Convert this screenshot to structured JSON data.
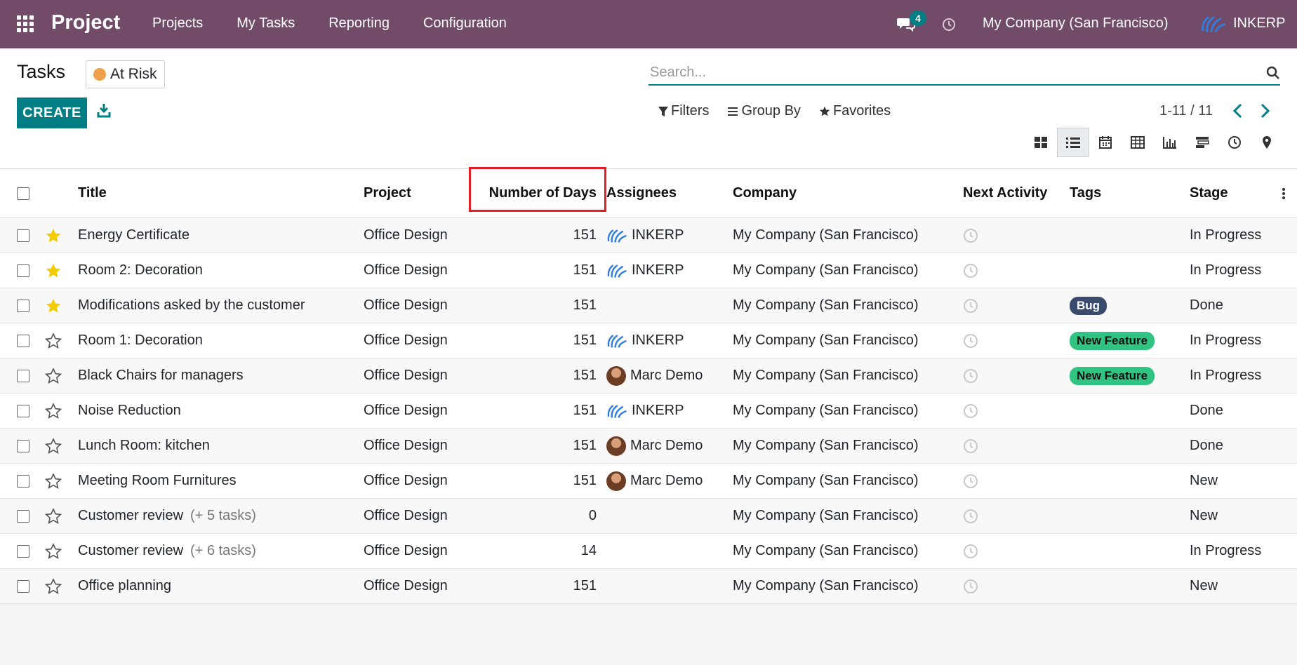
{
  "nav": {
    "brand": "Project",
    "menu": [
      "Projects",
      "My Tasks",
      "Reporting",
      "Configuration"
    ],
    "chat_count": "4",
    "company": "My Company (San Francisco)",
    "user": "INKERP"
  },
  "control": {
    "breadcrumb": "Tasks",
    "facet": "At Risk",
    "search_placeholder": "Search...",
    "create_label": "CREATE",
    "filters_label": "Filters",
    "groupby_label": "Group By",
    "favorites_label": "Favorites",
    "pager": "1-11 / 11"
  },
  "views": [
    "kanban",
    "list",
    "calendar",
    "pivot",
    "graph",
    "gantt",
    "activity",
    "map"
  ],
  "active_view": "list",
  "columns": {
    "title": "Title",
    "project": "Project",
    "days": "Number of Days",
    "assignees": "Assignees",
    "company": "Company",
    "activity": "Next Activity",
    "tags": "Tags",
    "stage": "Stage"
  },
  "rows": [
    {
      "starred": true,
      "title": "Energy Certificate",
      "subtasks": "",
      "project": "Office Design",
      "days": "151",
      "assignee": "INKERP",
      "assignee_type": "logo",
      "company": "My Company (San Francisco)",
      "tag": "",
      "stage": "In Progress"
    },
    {
      "starred": true,
      "title": "Room 2: Decoration",
      "subtasks": "",
      "project": "Office Design",
      "days": "151",
      "assignee": "INKERP",
      "assignee_type": "logo",
      "company": "My Company (San Francisco)",
      "tag": "",
      "stage": "In Progress"
    },
    {
      "starred": true,
      "title": "Modifications asked by the customer",
      "subtasks": "",
      "project": "Office Design",
      "days": "151",
      "assignee": "",
      "assignee_type": "",
      "company": "My Company (San Francisco)",
      "tag": "Bug",
      "stage": "Done"
    },
    {
      "starred": false,
      "title": "Room 1: Decoration",
      "subtasks": "",
      "project": "Office Design",
      "days": "151",
      "assignee": "INKERP",
      "assignee_type": "logo",
      "company": "My Company (San Francisco)",
      "tag": "New Feature",
      "stage": "In Progress"
    },
    {
      "starred": false,
      "title": "Black Chairs for managers",
      "subtasks": "",
      "project": "Office Design",
      "days": "151",
      "assignee": "Marc Demo",
      "assignee_type": "photo",
      "company": "My Company (San Francisco)",
      "tag": "New Feature",
      "stage": "In Progress"
    },
    {
      "starred": false,
      "title": "Noise Reduction",
      "subtasks": "",
      "project": "Office Design",
      "days": "151",
      "assignee": "INKERP",
      "assignee_type": "logo",
      "company": "My Company (San Francisco)",
      "tag": "",
      "stage": "Done"
    },
    {
      "starred": false,
      "title": "Lunch Room: kitchen",
      "subtasks": "",
      "project": "Office Design",
      "days": "151",
      "assignee": "Marc Demo",
      "assignee_type": "photo",
      "company": "My Company (San Francisco)",
      "tag": "",
      "stage": "Done"
    },
    {
      "starred": false,
      "title": "Meeting Room Furnitures",
      "subtasks": "",
      "project": "Office Design",
      "days": "151",
      "assignee": "Marc Demo",
      "assignee_type": "photo",
      "company": "My Company (San Francisco)",
      "tag": "",
      "stage": "New"
    },
    {
      "starred": false,
      "title": "Customer review",
      "subtasks": "(+ 5 tasks)",
      "project": "Office Design",
      "days": "0",
      "assignee": "",
      "assignee_type": "",
      "company": "My Company (San Francisco)",
      "tag": "",
      "stage": "New"
    },
    {
      "starred": false,
      "title": "Customer review",
      "subtasks": "(+ 6 tasks)",
      "project": "Office Design",
      "days": "14",
      "assignee": "",
      "assignee_type": "",
      "company": "My Company (San Francisco)",
      "tag": "",
      "stage": "In Progress"
    },
    {
      "starred": false,
      "title": "Office planning",
      "subtasks": "",
      "project": "Office Design",
      "days": "151",
      "assignee": "",
      "assignee_type": "",
      "company": "My Company (San Francisco)",
      "tag": "",
      "stage": "New"
    }
  ],
  "colors": {
    "nav_bg": "#714b67",
    "primary": "#017e84",
    "highlight": "#e51c23",
    "bug_tag": "#3b4b6e",
    "feature_tag": "#30c381",
    "star": "#f3cc00"
  }
}
